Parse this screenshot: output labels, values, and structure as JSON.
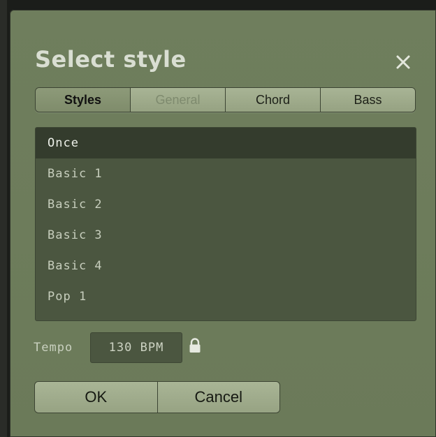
{
  "dialog": {
    "title": "Select style",
    "close_icon": "close-icon"
  },
  "tabs": [
    {
      "label": "Styles",
      "state": "active"
    },
    {
      "label": "General",
      "state": "disabled"
    },
    {
      "label": "Chord",
      "state": "normal"
    },
    {
      "label": "Bass",
      "state": "normal"
    }
  ],
  "styles_list": [
    {
      "label": "Once",
      "selected": true
    },
    {
      "label": "Basic 1",
      "selected": false
    },
    {
      "label": "Basic 2",
      "selected": false
    },
    {
      "label": "Basic 3",
      "selected": false
    },
    {
      "label": "Basic 4",
      "selected": false
    },
    {
      "label": "Pop 1",
      "selected": false
    }
  ],
  "tempo": {
    "label": "Tempo",
    "value": "130 BPM",
    "lock_icon": "lock-icon"
  },
  "actions": {
    "ok_label": "OK",
    "cancel_label": "Cancel"
  },
  "colors": {
    "dialog_bg": "#6f7e5d",
    "list_bg": "#4b5640",
    "selected_row": "#343c2d",
    "tab_bg": "#a8b495"
  }
}
